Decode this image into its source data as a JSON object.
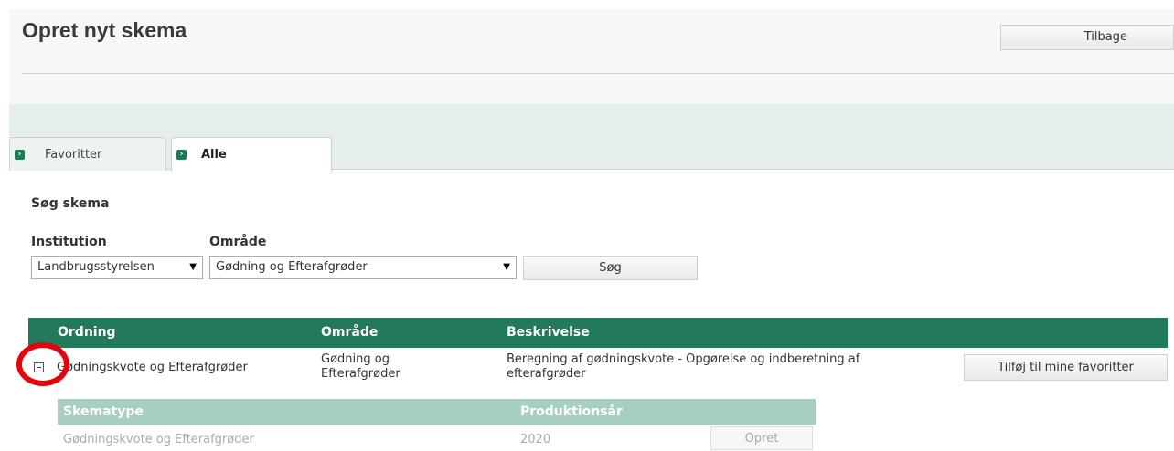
{
  "header": {
    "title": "Opret nyt skema",
    "back_label": "Tilbage"
  },
  "tabs": [
    {
      "label": "Favoritter",
      "active": false
    },
    {
      "label": "Alle",
      "active": true
    }
  ],
  "search": {
    "title": "Søg skema",
    "institution_label": "Institution",
    "institution_value": "Landbrugsstyrelsen",
    "area_label": "Område",
    "area_value": "Gødning og Efterafgrøder",
    "search_label": "Søg"
  },
  "table": {
    "headers": [
      "Ordning",
      "Område",
      "Beskrivelse"
    ],
    "rows": [
      {
        "ordning": "Gødningskvote og Efterafgrøder",
        "omraade_line1": "Gødning og",
        "omraade_line2": "Efterafgrøder",
        "beskrivelse_line1": "Beregning af gødningskvote - Opgørelse og indberetning af",
        "beskrivelse_line2": "efterafgrøder",
        "action_label": "Tilføj til mine favoritter",
        "expanded": true
      }
    ],
    "subtable": {
      "headers": [
        "Skematype",
        "Produktionsår"
      ],
      "rows": [
        {
          "skematype": "Gødningskvote og Efterafgrøder",
          "aar": "2020",
          "action_label": "Opret"
        }
      ]
    }
  },
  "colors": {
    "table_header": "#227a5a",
    "subtable_header": "#a6cfc1",
    "tab_band": "#e6eeec",
    "annotation": "#e8000b"
  }
}
